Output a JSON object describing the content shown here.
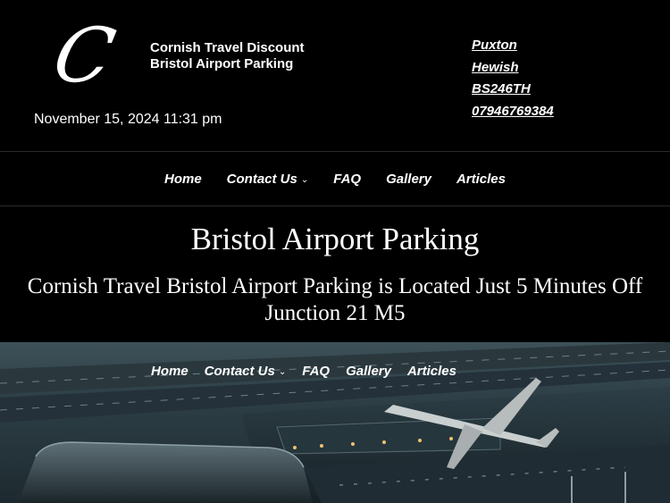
{
  "header": {
    "logo_letter": "C",
    "site_title_line1": "Cornish Travel Discount",
    "site_title_line2": "Bristol Airport Parking",
    "datetime": "November 15, 2024 11:31 pm",
    "address": [
      "Puxton",
      "Hewish",
      "BS246TH",
      "07946769384"
    ]
  },
  "nav": {
    "items": [
      "Home",
      "Contact Us",
      "FAQ",
      "Gallery",
      "Articles"
    ],
    "dropdown_icon": "chevron-down-icon"
  },
  "hero": {
    "title": "Bristol Airport Parking",
    "subtitle": "Cornish Travel Bristol Airport Parking is Located Just 5 Minutes Off Junction 21 M5"
  },
  "image_nav": {
    "items": [
      "Home",
      "Contact Us",
      "FAQ",
      "Gallery",
      "Articles"
    ]
  },
  "colors": {
    "background": "#000000",
    "text": "#ffffff",
    "image_dark": "#1d2a30",
    "image_light": "#3d5158"
  }
}
